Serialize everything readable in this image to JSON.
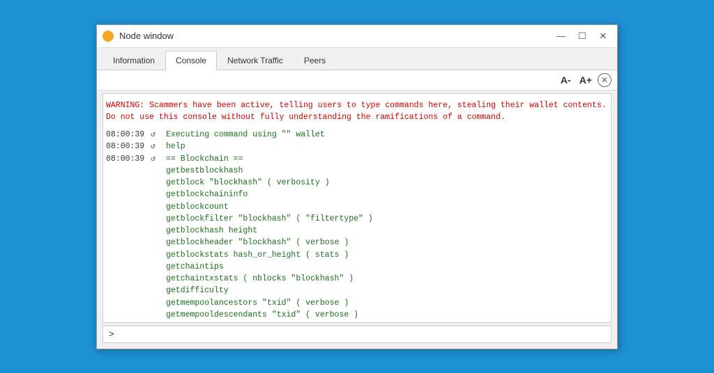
{
  "window": {
    "title": "Node window",
    "icon": "node-icon"
  },
  "title_bar": {
    "minimize_label": "—",
    "maximize_label": "☐",
    "close_label": "✕"
  },
  "tabs": [
    {
      "id": "information",
      "label": "Information",
      "active": false
    },
    {
      "id": "console",
      "label": "Console",
      "active": true
    },
    {
      "id": "network-traffic",
      "label": "Network Traffic",
      "active": false
    },
    {
      "id": "peers",
      "label": "Peers",
      "active": false
    }
  ],
  "toolbar": {
    "font_decrease_label": "A-",
    "font_increase_label": "A+",
    "close_label": "✕"
  },
  "console": {
    "warning": "WARNING: Scammers have been active, telling users to type commands here, stealing\ntheir wallet contents. Do not use this console without fully understanding the\nramifications of a command.",
    "log_entries": [
      {
        "time": "08:00:39",
        "icon": "refresh",
        "text": "Executing command using \"\" wallet"
      },
      {
        "time": "08:00:39",
        "icon": "refresh",
        "text": "help"
      },
      {
        "time": "08:00:39",
        "icon": "refresh",
        "text": "== Blockchain ==\ngetbestblockhash\ngetblock \"blockhash\" ( verbosity )\ngetblockchaininfo\ngetblockcount\ngetblockfilter \"blockhash\" ( \"filtertype\" )\ngetblockhash height\ngetblockheader \"blockhash\" ( verbose )\ngetblockstats hash_or_height ( stats )\ngetchaintips\ngetchaintxstats ( nblocks \"blockhash\" )\ngetdifficulty\ngetmempoolancestors \"txid\" ( verbose )\ngetmempooldescendants \"txid\" ( verbose )\ngetmempoolentry \"txid\"\ngetmempoolinfo"
      }
    ],
    "prompt_symbol": ">",
    "input_placeholder": ""
  }
}
